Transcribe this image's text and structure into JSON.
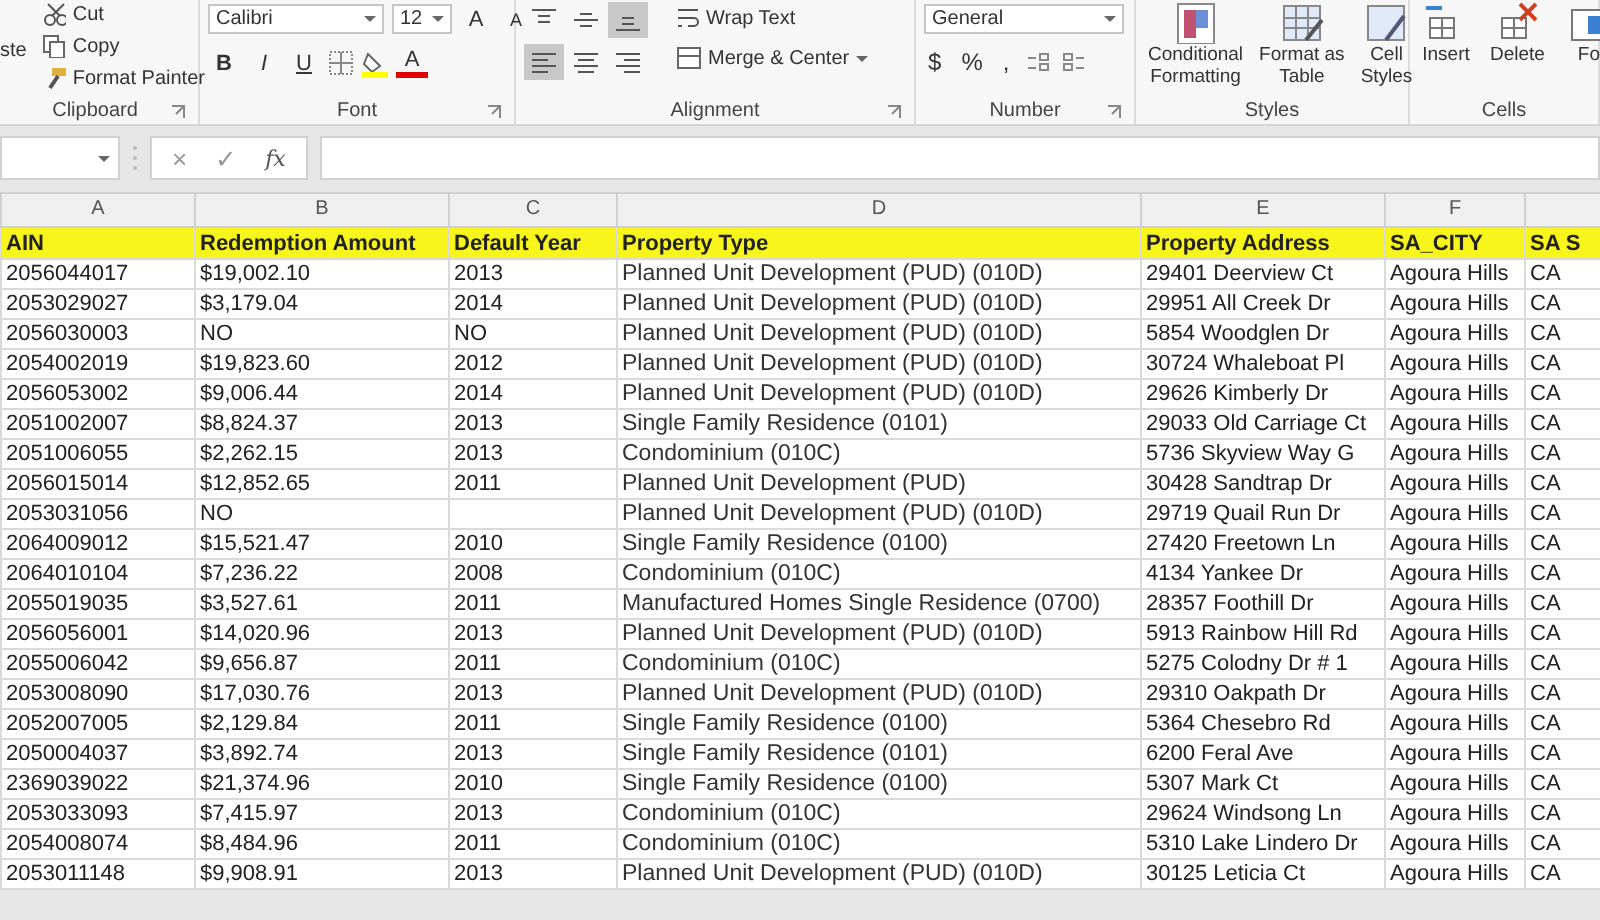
{
  "ribbon": {
    "groups": [
      {
        "kind": "clipboard",
        "label": "Clipboard",
        "paste": "ste",
        "buttons": [
          {
            "kind": "cut",
            "label": "Cut"
          },
          {
            "kind": "copy",
            "label": "Copy"
          },
          {
            "kind": "painter",
            "label": "Format Painter"
          }
        ]
      },
      {
        "kind": "font",
        "label": "Font",
        "font_name": "Calibri",
        "font_size": "12",
        "size_buttons": [
          "A",
          "A"
        ],
        "format_buttons": [
          "B",
          "I",
          "U"
        ],
        "font_color": "A"
      },
      {
        "kind": "alignment",
        "label": "Alignment",
        "align_buttons": [
          {
            "kind": "top",
            "selected": false
          },
          {
            "kind": "middle",
            "selected": false
          },
          {
            "kind": "bottom",
            "selected": true
          },
          {
            "kind": "left",
            "selected": true
          },
          {
            "kind": "center",
            "selected": false
          },
          {
            "kind": "right",
            "selected": false
          }
        ],
        "wrap": "Wrap Text",
        "merge": "Merge & Center"
      },
      {
        "kind": "number",
        "label": "Number",
        "format": "General",
        "symbols": [
          "$",
          "%",
          ","
        ]
      },
      {
        "kind": "styles",
        "label": "Styles",
        "buttons": [
          {
            "kind": "conditional",
            "lines": [
              "Conditional",
              "Formatting"
            ]
          },
          {
            "kind": "table",
            "lines": [
              "Format as",
              "Table"
            ]
          },
          {
            "kind": "cellstyles",
            "lines": [
              "Cell",
              "Styles"
            ]
          }
        ]
      },
      {
        "kind": "cells",
        "label": "Cells",
        "buttons": [
          {
            "kind": "insert",
            "label": "Insert"
          },
          {
            "kind": "delete",
            "label": "Delete"
          },
          {
            "kind": "format",
            "label": "Fo"
          }
        ]
      }
    ]
  },
  "formula_bar": {
    "cancel": "×",
    "enter": "✓",
    "function": "fx"
  },
  "sheet": {
    "columns": [
      {
        "letter": "A",
        "title": "AIN"
      },
      {
        "letter": "B",
        "title": "Redemption Amount"
      },
      {
        "letter": "C",
        "title": "Default Year"
      },
      {
        "letter": "D",
        "title": "Property Type"
      },
      {
        "letter": "E",
        "title": "Property Address"
      },
      {
        "letter": "F",
        "title": "SA_CITY"
      },
      {
        "title": "SA S"
      }
    ],
    "rows": [
      [
        "2056044017",
        "$19,002.10",
        "2013",
        "Planned Unit Development (PUD) (010D)",
        "29401 Deerview Ct",
        "Agoura Hills",
        "CA"
      ],
      [
        "2053029027",
        "$3,179.04",
        "2014",
        "Planned Unit Development (PUD) (010D)",
        "29951 All Creek Dr",
        "Agoura Hills",
        "CA"
      ],
      [
        "2056030003",
        "NO",
        "NO",
        "Planned Unit Development (PUD) (010D)",
        "5854 Woodglen Dr",
        "Agoura Hills",
        "CA"
      ],
      [
        "2054002019",
        "$19,823.60",
        "2012",
        "Planned Unit Development (PUD) (010D)",
        "30724 Whaleboat Pl",
        "Agoura Hills",
        "CA"
      ],
      [
        "2056053002",
        "$9,006.44",
        "2014",
        "Planned Unit Development (PUD) (010D)",
        "29626 Kimberly Dr",
        "Agoura Hills",
        "CA"
      ],
      [
        "2051002007",
        "$8,824.37",
        "2013",
        "Single Family Residence (0101)",
        "29033 Old Carriage Ct",
        "Agoura Hills",
        "CA"
      ],
      [
        "2051006055",
        "$2,262.15",
        "2013",
        "Condominium (010C)",
        "5736 Skyview Way G",
        "Agoura Hills",
        "CA"
      ],
      [
        "2056015014",
        "$12,852.65",
        "2011",
        "Planned Unit Development (PUD)",
        "30428 Sandtrap Dr",
        "Agoura Hills",
        "CA"
      ],
      [
        "2053031056",
        "NO",
        "",
        "Planned Unit Development (PUD) (010D)",
        "29719 Quail Run Dr",
        "Agoura Hills",
        "CA"
      ],
      [
        "2064009012",
        "$15,521.47",
        "2010",
        "Single Family Residence (0100)",
        "27420 Freetown Ln",
        "Agoura Hills",
        "CA"
      ],
      [
        "2064010104",
        "$7,236.22",
        "2008",
        "Condominium (010C)",
        "4134 Yankee Dr",
        "Agoura Hills",
        "CA"
      ],
      [
        "2055019035",
        "$3,527.61",
        "2011",
        "Manufactured Homes Single Residence (0700)",
        "28357 Foothill Dr",
        "Agoura Hills",
        "CA"
      ],
      [
        "2056056001",
        "$14,020.96",
        "2013",
        "Planned Unit Development (PUD) (010D)",
        "5913 Rainbow Hill Rd",
        "Agoura Hills",
        "CA"
      ],
      [
        "2055006042",
        "$9,656.87",
        "2011",
        "Condominium (010C)",
        "5275 Colodny Dr # 1",
        "Agoura Hills",
        "CA"
      ],
      [
        "2053008090",
        "$17,030.76",
        "2013",
        "Planned Unit Development (PUD) (010D)",
        "29310 Oakpath Dr",
        "Agoura Hills",
        "CA"
      ],
      [
        "2052007005",
        "$2,129.84",
        "2011",
        "Single Family Residence (0100)",
        "5364 Chesebro Rd",
        "Agoura Hills",
        "CA"
      ],
      [
        "2050004037",
        "$3,892.74",
        "2013",
        "Single Family Residence (0101)",
        "6200 Feral Ave",
        "Agoura Hills",
        "CA"
      ],
      [
        "2369039022",
        "$21,374.96",
        "2010",
        "Single Family Residence (0100)",
        "5307 Mark Ct",
        "Agoura Hills",
        "CA"
      ],
      [
        "2053033093",
        "$7,415.97",
        "2013",
        "Condominium (010C)",
        "29624 Windsong Ln",
        "Agoura Hills",
        "CA"
      ],
      [
        "2054008074",
        "$8,484.96",
        "2011",
        "Condominium (010C)",
        "5310 Lake Lindero Dr",
        "Agoura Hills",
        "CA"
      ],
      [
        "2053011148",
        "$9,908.91",
        "2013",
        "Planned Unit Development (PUD) (010D)",
        "30125 Leticia Ct",
        "Agoura Hills",
        "CA"
      ]
    ]
  }
}
